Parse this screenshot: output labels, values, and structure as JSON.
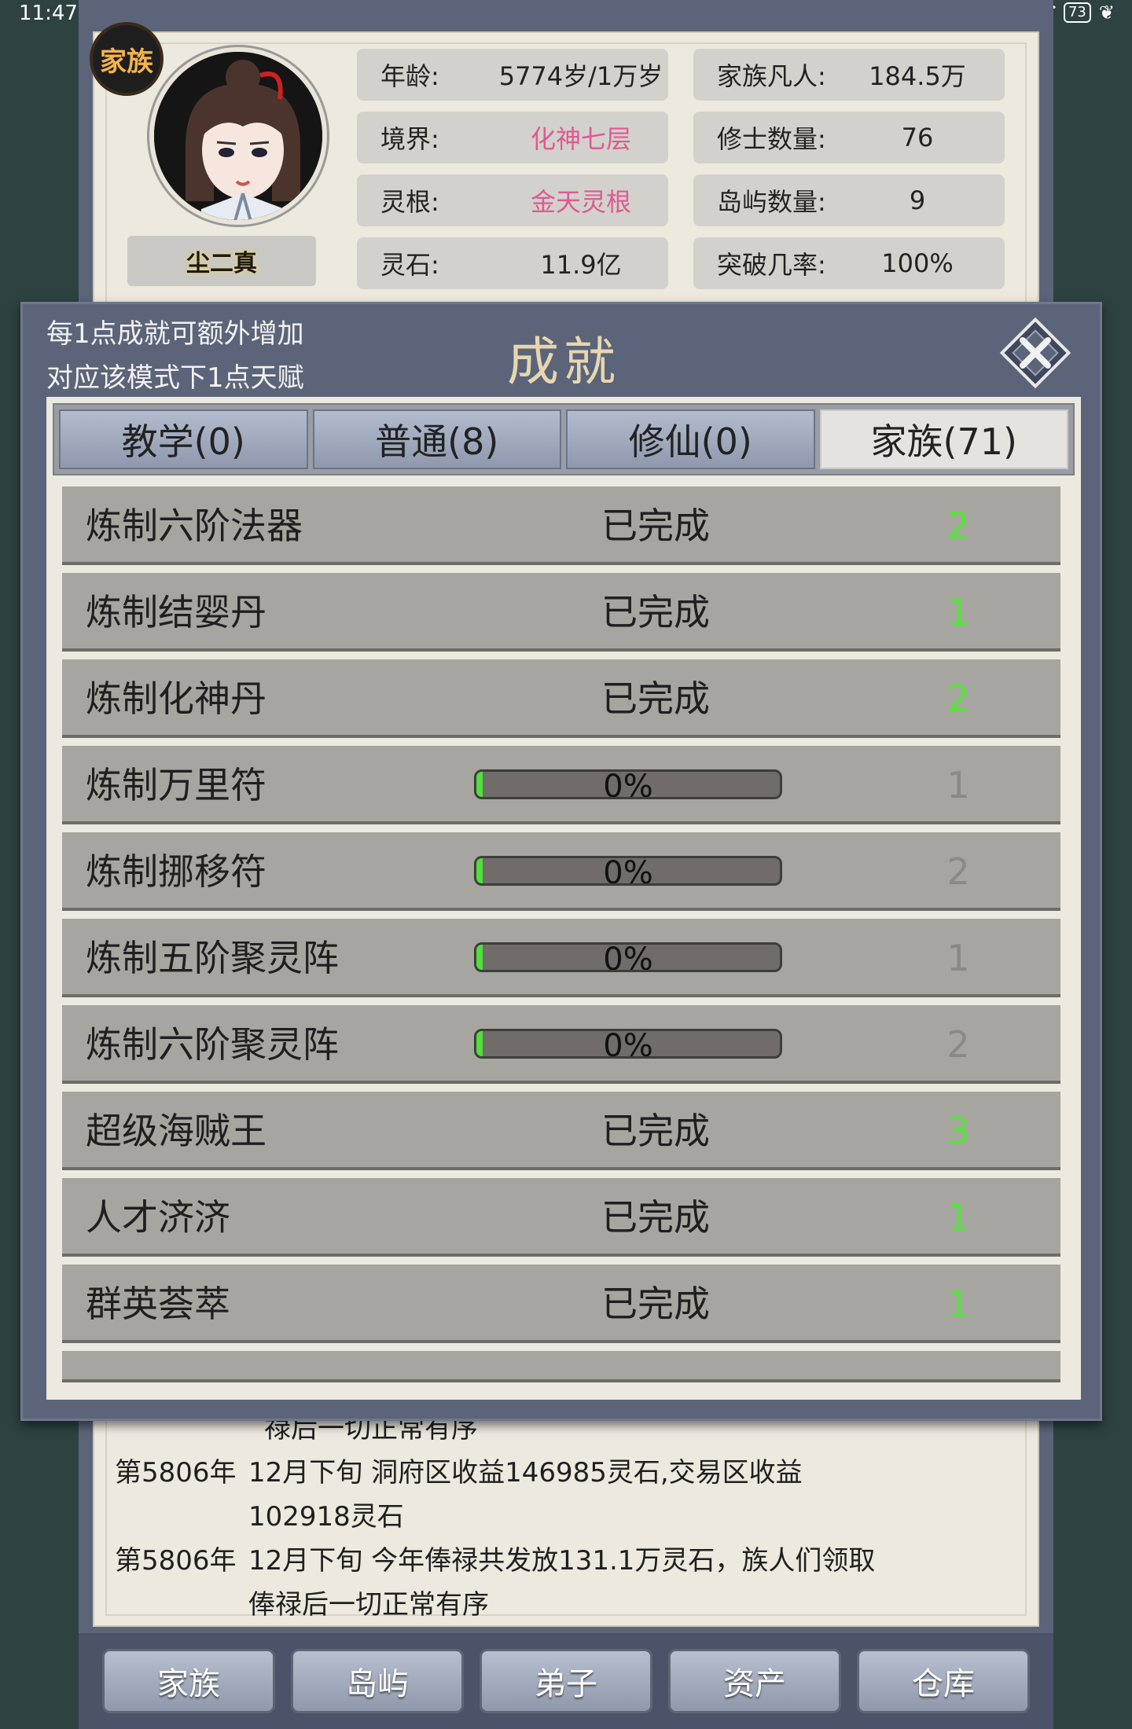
{
  "status_bar": {
    "time": "11:47",
    "battery": "73"
  },
  "profile": {
    "clan_badge": "家族",
    "name": "尘二真",
    "stats": [
      {
        "label": "年龄:",
        "value": "5774岁/1万岁",
        "highlight": false
      },
      {
        "label": "家族凡人:",
        "value": "184.5万",
        "highlight": false
      },
      {
        "label": "境界:",
        "value": "化神七层",
        "highlight": true
      },
      {
        "label": "修士数量:",
        "value": "76",
        "highlight": false
      },
      {
        "label": "灵根:",
        "value": "金天灵根",
        "highlight": true
      },
      {
        "label": "岛屿数量:",
        "value": "9",
        "highlight": false
      },
      {
        "label": "灵石:",
        "value": "11.9亿",
        "highlight": false
      },
      {
        "label": "突破几率:",
        "value": "100%",
        "highlight": false
      }
    ]
  },
  "modal": {
    "hint_line1": "每1点成就可额外增加",
    "hint_line2": "对应该模式下1点天赋",
    "title": "成就",
    "tabs": [
      {
        "label": "教学(0)",
        "active": false
      },
      {
        "label": "普通(8)",
        "active": false
      },
      {
        "label": "修仙(0)",
        "active": false
      },
      {
        "label": "家族(71)",
        "active": true
      }
    ],
    "achievements": [
      {
        "name": "炼制六阶法器",
        "status": "已完成",
        "completed": true,
        "reward": "2"
      },
      {
        "name": "炼制结婴丹",
        "status": "已完成",
        "completed": true,
        "reward": "1"
      },
      {
        "name": "炼制化神丹",
        "status": "已完成",
        "completed": true,
        "reward": "2"
      },
      {
        "name": "炼制万里符",
        "status": "0%",
        "completed": false,
        "progress": 0,
        "reward": "1"
      },
      {
        "name": "炼制挪移符",
        "status": "0%",
        "completed": false,
        "progress": 0,
        "reward": "2"
      },
      {
        "name": "炼制五阶聚灵阵",
        "status": "0%",
        "completed": false,
        "progress": 0,
        "reward": "1"
      },
      {
        "name": "炼制六阶聚灵阵",
        "status": "0%",
        "completed": false,
        "progress": 0,
        "reward": "2"
      },
      {
        "name": "超级海贼王",
        "status": "已完成",
        "completed": true,
        "reward": "3"
      },
      {
        "name": "人才济济",
        "status": "已完成",
        "completed": true,
        "reward": "1"
      },
      {
        "name": "群英荟萃",
        "status": "已完成",
        "completed": true,
        "reward": "1"
      }
    ]
  },
  "log": [
    {
      "year": "",
      "text": "禄后一切正常有序"
    },
    {
      "year": "第5806年",
      "text": "12月下旬 洞府区收益146985灵石,交易区收益"
    },
    {
      "year": "",
      "text": "102918灵石"
    },
    {
      "year": "第5806年",
      "text": "12月下旬 今年俸禄共发放131.1万灵石，族人们领取"
    },
    {
      "year": "",
      "text": "俸禄后一切正常有序"
    }
  ],
  "nav": [
    {
      "label": "家族"
    },
    {
      "label": "岛屿"
    },
    {
      "label": "弟子"
    },
    {
      "label": "资产"
    },
    {
      "label": "仓库"
    }
  ],
  "colors": {
    "frame": "#5b6479",
    "paper": "#ece9df",
    "highlight_pink": "#de5a92",
    "reward_done": "#55e23a",
    "reward_todo": "#8a8986",
    "title_gold": "#e7d6b0"
  }
}
